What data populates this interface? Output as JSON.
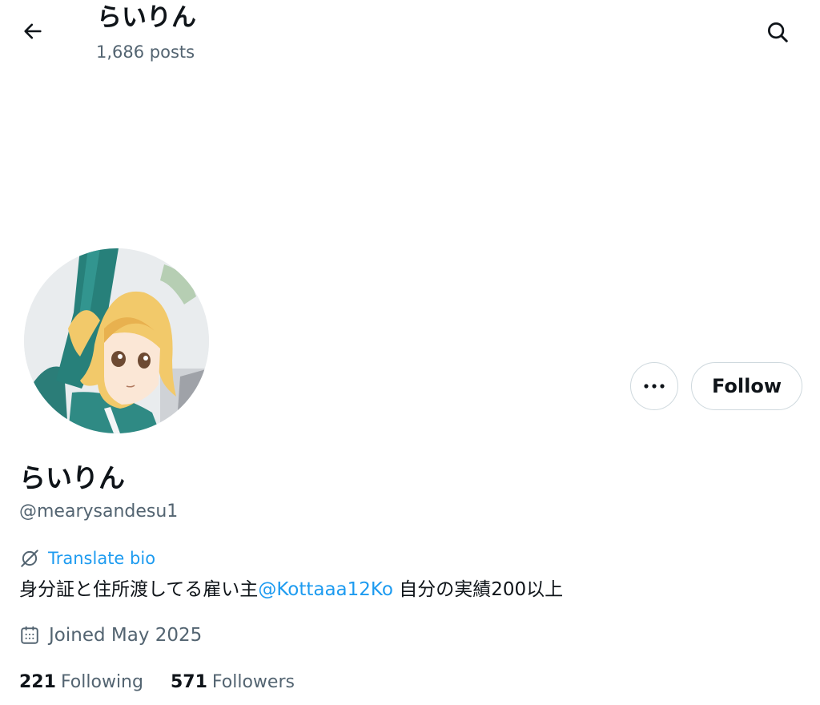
{
  "header": {
    "title": "らいりん",
    "post_count": "1,686 posts",
    "back_icon": "arrow-left-icon",
    "search_icon": "search-icon"
  },
  "profile": {
    "display_name": "らいりん",
    "handle": "@mearysandesu1",
    "more_icon": "more-horizontal-icon",
    "follow_label": "Follow",
    "translate_label": "Translate bio",
    "bio_before": "身分証と住所渡してる雇い主",
    "bio_mention": "@Kottaaa12Ko",
    "bio_after": " 自分の実績200以上",
    "joined": "Joined May 2025",
    "following_count": "221",
    "following_label": "Following",
    "followers_count": "571",
    "followers_label": "Followers"
  },
  "colors": {
    "accent": "#1d9bf0",
    "text_primary": "#0f1419",
    "text_secondary": "#536471",
    "border": "#cfd9de"
  }
}
